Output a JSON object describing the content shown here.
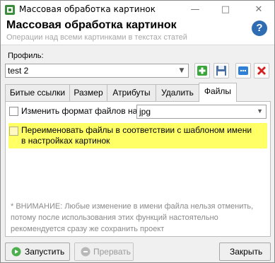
{
  "window": {
    "title": "Массовая обработка картинок",
    "minimize": "—",
    "maximize": "□",
    "close": "✕"
  },
  "header": {
    "title": "Массовая обработка картинок",
    "subtitle": "Операции над всеми картинками в текстах статей",
    "help": "?"
  },
  "profile": {
    "label": "Профиль:",
    "value": "test 2",
    "arrow": "▼",
    "toolbar": [
      "add-icon",
      "save-icon",
      "more-icon",
      "delete-icon"
    ],
    "more_label": "···"
  },
  "tabs": [
    {
      "label": "Битые ссылки",
      "active": false
    },
    {
      "label": "Размер",
      "active": false
    },
    {
      "label": "Атрибуты",
      "active": false
    },
    {
      "label": "Удалить",
      "active": false
    },
    {
      "label": "Файлы",
      "active": true
    }
  ],
  "files_tab": {
    "change_format_label": "Изменить формат файлов на:",
    "change_format_checked": false,
    "format_value": "jpg",
    "format_arrow": "▼",
    "rename_label": "Переименовать файлы в соответствии с шаблоном имени в настройках картинок",
    "rename_checked": false,
    "note": "* ВНИМАНИЕ: Любые изменение в имени файла нельзя отменить, потому после использования этих функций настоятельно рекомендуется сразу же сохранить проект"
  },
  "buttons": {
    "run": "Запустить",
    "stop": "Прервать",
    "close": "Закрыть"
  },
  "colors": {
    "highlight": "#ffff66",
    "help_bg": "#2f6db3",
    "add_green": "#3aa53a",
    "delete_red": "#d42020"
  }
}
